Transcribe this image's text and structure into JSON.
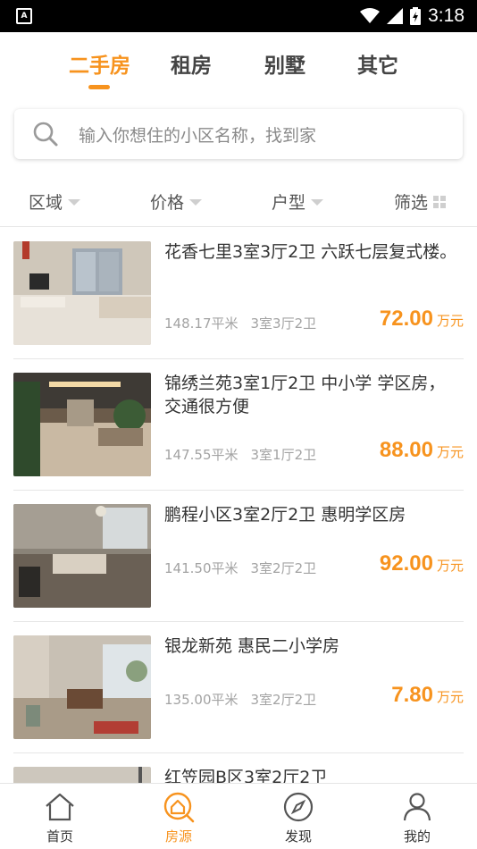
{
  "status_bar": {
    "time": "3:18",
    "left_icon": "A"
  },
  "tabs": [
    {
      "label": "二手房",
      "active": true
    },
    {
      "label": "租房",
      "active": false
    },
    {
      "label": "别墅",
      "active": false
    },
    {
      "label": "其它",
      "active": false
    }
  ],
  "search": {
    "placeholder": "输入你想住的小区名称，找到家",
    "icon": "search-icon"
  },
  "filters": [
    {
      "label": "区域",
      "icon": "caret-down-icon"
    },
    {
      "label": "价格",
      "icon": "caret-down-icon"
    },
    {
      "label": "户型",
      "icon": "caret-down-icon"
    },
    {
      "label": "筛选",
      "icon": "grid-icon"
    }
  ],
  "listings": [
    {
      "title": "花香七里3室3厅2卫 六跃七层复式楼。",
      "area": "148.17平米",
      "layout": "3室3厅2卫",
      "price": "72.00",
      "unit": "万元"
    },
    {
      "title": "锦绣兰苑3室1厅2卫  中小学 学区房，交通很方便",
      "area": "147.55平米",
      "layout": "3室1厅2卫",
      "price": "88.00",
      "unit": "万元"
    },
    {
      "title": "鹏程小区3室2厅2卫 惠明学区房",
      "area": "141.50平米",
      "layout": "3室2厅2卫",
      "price": "92.00",
      "unit": "万元"
    },
    {
      "title": "银龙新苑 惠民二小学房",
      "area": "135.00平米",
      "layout": "3室2厅2卫",
      "price": "7.80",
      "unit": "万元"
    },
    {
      "title": "红笠园B区3室2厅2卫",
      "area": "",
      "layout": "",
      "price": "",
      "unit": ""
    }
  ],
  "bottom_nav": [
    {
      "label": "首页",
      "icon": "home-icon",
      "active": false
    },
    {
      "label": "房源",
      "icon": "house-search-icon",
      "active": true
    },
    {
      "label": "发现",
      "icon": "compass-icon",
      "active": false
    },
    {
      "label": "我的",
      "icon": "user-icon",
      "active": false
    }
  ],
  "colors": {
    "accent": "#f7931e",
    "text": "#333333",
    "muted": "#a3a3a3"
  }
}
